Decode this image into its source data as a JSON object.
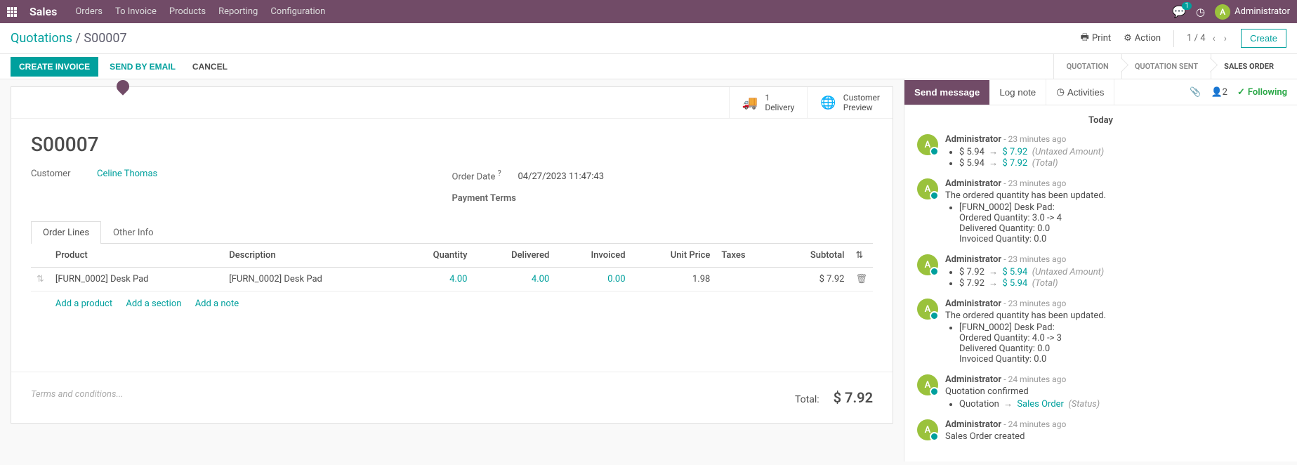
{
  "topbar": {
    "app_title": "Sales",
    "menu": [
      "Orders",
      "To Invoice",
      "Products",
      "Reporting",
      "Configuration"
    ],
    "chat_count": "1",
    "user_name": "Administrator",
    "user_initial": "A"
  },
  "breadcrumb": {
    "root": "Quotations",
    "current": "S00007"
  },
  "controls": {
    "print": "Print",
    "action": "Action",
    "pager": "1 / 4",
    "create": "Create"
  },
  "statusbar": {
    "create_invoice": "CREATE INVOICE",
    "send_email": "SEND BY EMAIL",
    "cancel": "CANCEL",
    "steps": [
      "QUOTATION",
      "QUOTATION SENT",
      "SALES ORDER"
    ]
  },
  "buttonbox": {
    "delivery_count": "1",
    "delivery_label": "Delivery",
    "preview_top": "Customer",
    "preview_bottom": "Preview"
  },
  "order": {
    "name": "S00007",
    "customer_label": "Customer",
    "customer": "Celine Thomas",
    "orderdate_label": "Order Date",
    "orderdate": "04/27/2023 11:47:43",
    "payterms_label": "Payment Terms"
  },
  "tabs": {
    "lines": "Order Lines",
    "other": "Other Info"
  },
  "table": {
    "headers": {
      "product": "Product",
      "description": "Description",
      "qty": "Quantity",
      "delivered": "Delivered",
      "invoiced": "Invoiced",
      "unitprice": "Unit Price",
      "taxes": "Taxes",
      "subtotal": "Subtotal"
    },
    "rows": [
      {
        "product": "[FURN_0002] Desk Pad",
        "description": "[FURN_0002] Desk Pad",
        "qty": "4.00",
        "delivered": "4.00",
        "invoiced": "0.00",
        "unitprice": "1.98",
        "subtotal": "$ 7.92"
      }
    ],
    "add_product": "Add a product",
    "add_section": "Add a section",
    "add_note": "Add a note"
  },
  "footer": {
    "terms_placeholder": "Terms and conditions...",
    "total_label": "Total:",
    "total_value": "$ 7.92"
  },
  "chatter": {
    "send": "Send message",
    "log": "Log note",
    "activities": "Activities",
    "followers": "2",
    "following": "Following",
    "separator": "Today",
    "messages": [
      {
        "author": "Administrator",
        "time": "- 23 minutes ago",
        "changes": [
          {
            "old": "$ 5.94",
            "new": "$ 7.92",
            "field": "(Untaxed Amount)"
          },
          {
            "old": "$ 5.94",
            "new": "$ 7.92",
            "field": "(Total)"
          }
        ]
      },
      {
        "author": "Administrator",
        "time": "- 23 minutes ago",
        "body": "The ordered quantity has been updated.",
        "details": [
          "[FURN_0002] Desk Pad:",
          "Ordered Quantity: 3.0 -> 4",
          "Delivered Quantity: 0.0",
          "Invoiced Quantity: 0.0"
        ]
      },
      {
        "author": "Administrator",
        "time": "- 23 minutes ago",
        "changes": [
          {
            "old": "$ 7.92",
            "new": "$ 5.94",
            "field": "(Untaxed Amount)"
          },
          {
            "old": "$ 7.92",
            "new": "$ 5.94",
            "field": "(Total)"
          }
        ]
      },
      {
        "author": "Administrator",
        "time": "- 23 minutes ago",
        "body": "The ordered quantity has been updated.",
        "details": [
          "[FURN_0002] Desk Pad:",
          "Ordered Quantity: 4.0 -> 3",
          "Delivered Quantity: 0.0",
          "Invoiced Quantity: 0.0"
        ]
      },
      {
        "author": "Administrator",
        "time": "- 24 minutes ago",
        "body": "Quotation confirmed",
        "changes": [
          {
            "old": "Quotation",
            "new": "Sales Order",
            "field": "(Status)"
          }
        ]
      },
      {
        "author": "Administrator",
        "time": "- 24 minutes ago",
        "body": "Sales Order created"
      }
    ]
  }
}
